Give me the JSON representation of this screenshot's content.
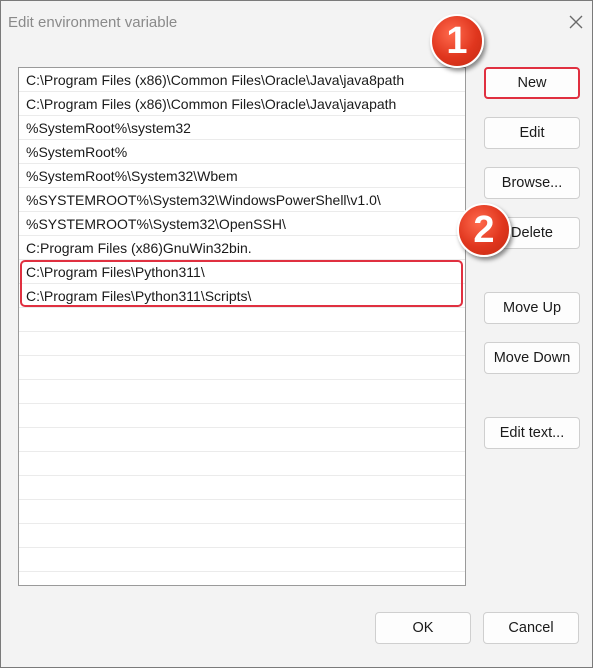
{
  "window": {
    "title": "Edit environment variable",
    "close_icon": "close-icon"
  },
  "list": {
    "items": [
      "C:\\Program Files (x86)\\Common Files\\Oracle\\Java\\java8path",
      "C:\\Program Files (x86)\\Common Files\\Oracle\\Java\\javapath",
      "%SystemRoot%\\system32",
      "%SystemRoot%",
      "%SystemRoot%\\System32\\Wbem",
      "%SYSTEMROOT%\\System32\\WindowsPowerShell\\v1.0\\",
      "%SYSTEMROOT%\\System32\\OpenSSH\\",
      "C:Program Files (x86)GnuWin32bin.",
      "C:\\Program Files\\Python311\\",
      "C:\\Program Files\\Python311\\Scripts\\"
    ]
  },
  "buttons": {
    "new": "New",
    "edit": "Edit",
    "browse": "Browse...",
    "delete": "Delete",
    "move_up": "Move Up",
    "move_down": "Move Down",
    "edit_text": "Edit text...",
    "ok": "OK",
    "cancel": "Cancel"
  },
  "annotations": {
    "badge_1": "1",
    "badge_2": "2",
    "accent_color": "#e03040"
  }
}
